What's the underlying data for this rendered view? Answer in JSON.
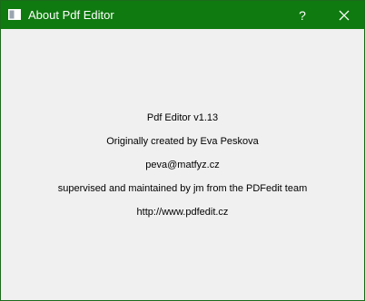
{
  "window": {
    "title": "About Pdf Editor",
    "help_label": "?",
    "close_icon": "close-icon",
    "app_icon": "window-app-icon",
    "titlebar_color": "#0f7a0f"
  },
  "about": {
    "app_name": "Pdf Editor v1.13",
    "created_by": "Originally created by Eva Peskova",
    "email": "peva@matfyz.cz",
    "maintained_by": "supervised and maintained by jm from the PDFedit team",
    "website": "http://www.pdfedit.cz"
  }
}
